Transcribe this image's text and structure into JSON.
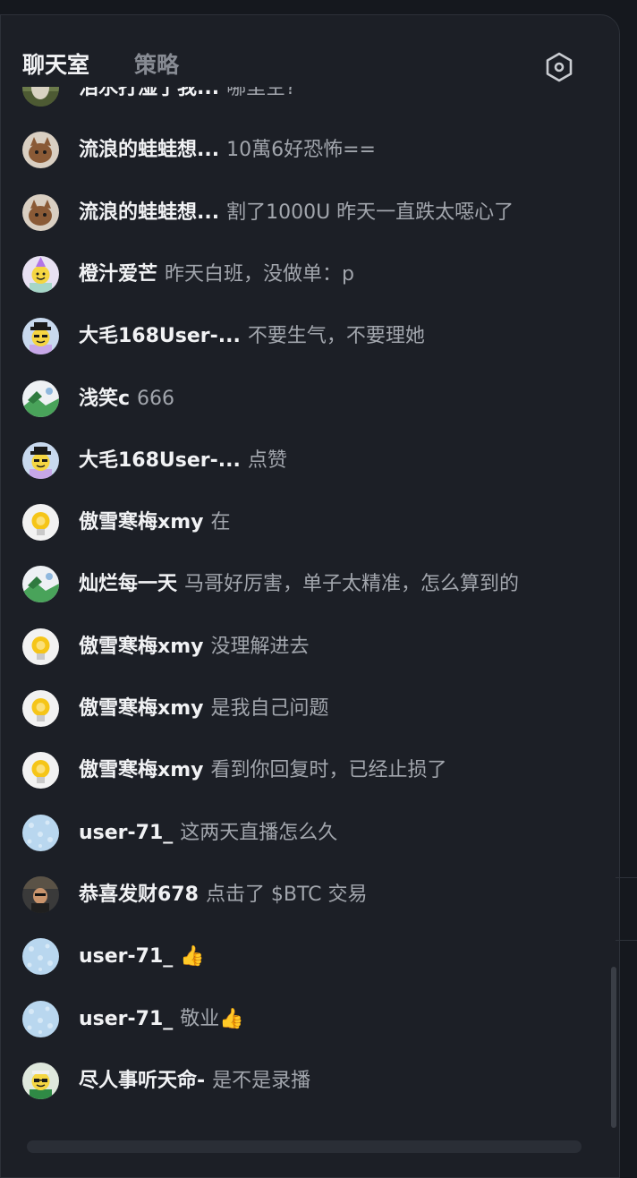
{
  "tabs": {
    "chat": "聊天室",
    "strategy": "策略"
  },
  "settings_icon": "hexagon-settings-icon",
  "messages": [
    {
      "user": "泪水打湿了我...",
      "text": "哪里空?",
      "avatar": "dog"
    },
    {
      "user": "流浪的蛙蛙想...",
      "text": "10萬6好恐怖==",
      "avatar": "cat"
    },
    {
      "user": "流浪的蛙蛙想...",
      "text": "割了1000U 昨天一直跌太噁心了",
      "avatar": "cat"
    },
    {
      "user": "橙汁爱芒",
      "text": "昨天白班，没做单：p",
      "avatar": "smiley-party"
    },
    {
      "user": "大毛168User-...",
      "text": "不要生气，不要理她",
      "avatar": "smiley-hat"
    },
    {
      "user": "浅笑c",
      "text": "666",
      "avatar": "landscape"
    },
    {
      "user": "大毛168User-...",
      "text": "点赞",
      "avatar": "smiley-hat"
    },
    {
      "user": "傲雪寒梅xmy",
      "text": "在",
      "avatar": "bulb"
    },
    {
      "user": "灿烂每一天",
      "text": "马哥好厉害，单子太精准，怎么算到的",
      "avatar": "landscape"
    },
    {
      "user": "傲雪寒梅xmy",
      "text": "没理解进去",
      "avatar": "bulb"
    },
    {
      "user": "傲雪寒梅xmy",
      "text": "是我自己问题",
      "avatar": "bulb"
    },
    {
      "user": "傲雪寒梅xmy",
      "text": "看到你回复时，已经止损了",
      "avatar": "bulb"
    },
    {
      "user": "user-71_",
      "text": "这两天直播怎么久",
      "avatar": "blue-pattern"
    },
    {
      "user": "恭喜发财678",
      "text": "点击了 $BTC 交易",
      "avatar": "photo-person"
    },
    {
      "user": "user-71_",
      "text": "👍",
      "avatar": "blue-pattern"
    },
    {
      "user": "user-71_",
      "text": "敬业👍",
      "avatar": "blue-pattern"
    },
    {
      "user": "尽人事听天命-",
      "text": "是不是录播",
      "avatar": "smiley-sunglasses"
    }
  ]
}
